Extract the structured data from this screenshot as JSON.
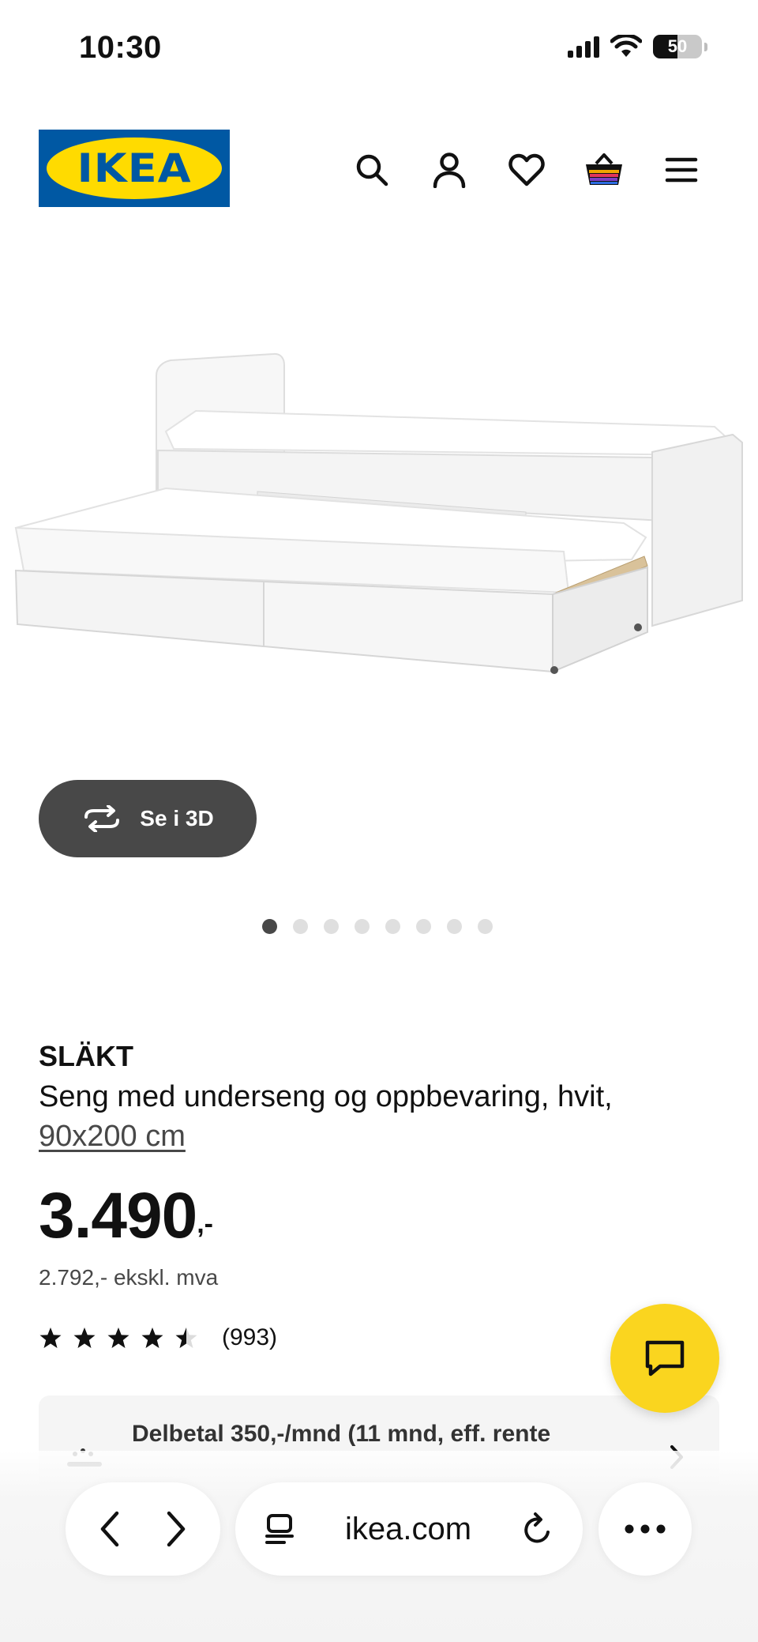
{
  "status_bar": {
    "time": "10:30",
    "battery": "50",
    "battery_level_percent": 50
  },
  "header": {
    "logo_text": "IKEA",
    "icons": [
      "search-icon",
      "account-icon",
      "favorites-icon",
      "cart-icon",
      "menu-icon"
    ],
    "brand_blue": "#0058a3",
    "brand_yellow": "#ffdb00"
  },
  "gallery": {
    "view_3d_label": "Se i 3D",
    "dots_total": 8,
    "active_dot": 1
  },
  "product": {
    "name": "SLÄKT",
    "description": "Seng med underseng og oppbevaring, hvit,",
    "size": "90x200 cm",
    "price": "3.490",
    "price_suffix": ",-",
    "price_ex_vat": "2.792,- ekskl. mva",
    "rating_stars": 4.5,
    "rating_count": "(993)"
  },
  "financing": {
    "text": "Delbetal 350,-/mnd (11 mnd, eff. rente"
  },
  "chat": {
    "icon": "chat-icon",
    "color": "#fad51f"
  },
  "browser": {
    "url": "ikea.com",
    "icons": [
      "back-icon",
      "forward-icon",
      "reader-icon",
      "reload-icon",
      "more-icon"
    ]
  }
}
